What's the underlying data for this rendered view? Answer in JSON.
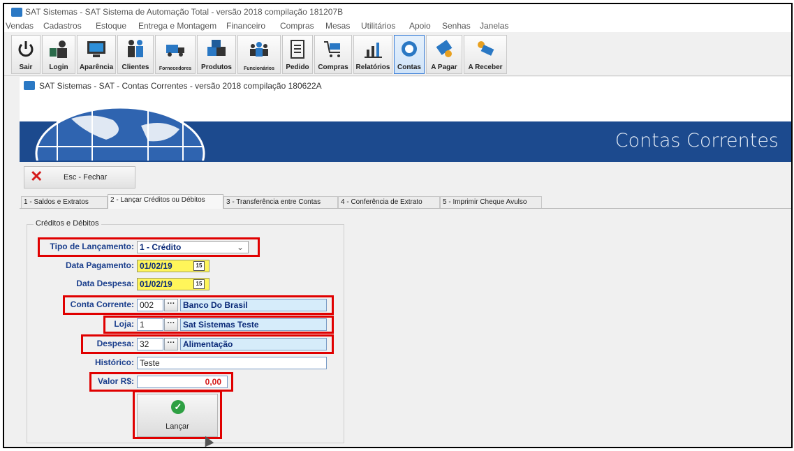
{
  "app": {
    "title": "SAT Sistemas - SAT Sistema de Automação Total - versão 2018 compilação 181207B"
  },
  "menu": [
    "Vendas",
    "Cadastros",
    "Estoque",
    "Entrega e Montagem",
    "Financeiro",
    "Compras",
    "Mesas",
    "Utilitários",
    "Apoio",
    "Senhas",
    "Janelas"
  ],
  "toolbar": [
    {
      "label": "Sair",
      "icon": "power-icon"
    },
    {
      "label": "Login",
      "icon": "login-icon"
    },
    {
      "label": "Aparência",
      "icon": "monitor-icon"
    },
    {
      "label": "Clientes",
      "icon": "clients-icon"
    },
    {
      "label": "Fornecedores",
      "icon": "truck-icon"
    },
    {
      "label": "Produtos",
      "icon": "boxes-icon"
    },
    {
      "label": "Funcionários",
      "icon": "team-icon"
    },
    {
      "label": "Pedido",
      "icon": "clipboard-icon"
    },
    {
      "label": "Compras",
      "icon": "cart-icon"
    },
    {
      "label": "Relatórios",
      "icon": "bar-chart-icon"
    },
    {
      "label": "Contas",
      "icon": "coins-icon"
    },
    {
      "label": "A Pagar",
      "icon": "pay-icon"
    },
    {
      "label": "A Receber",
      "icon": "receive-icon"
    }
  ],
  "child_window": {
    "title": "SAT Sistemas - SAT - Contas Correntes - versão 2018 compilação 180622A",
    "banner_title": "Contas Correntes",
    "close_label": "Esc - Fechar"
  },
  "tabs": [
    "1 - Saldos e Extratos",
    "2 - Lançar Créditos ou Débitos",
    "3 - Transferência entre Contas",
    "4 - Conferência de Extrato",
    "5 - Imprimir Cheque Avulso"
  ],
  "form": {
    "group_title": "Créditos e Débitos",
    "tipo_label": "Tipo de Lançamento:",
    "tipo_value": "1 - Crédito",
    "data_pagamento_label": "Data Pagamento:",
    "data_pagamento_value": "01/02/19",
    "data_despesa_label": "Data Despesa:",
    "data_despesa_value": "01/02/19",
    "conta_label": "Conta Corrente:",
    "conta_code": "002",
    "conta_name": "Banco Do Brasil",
    "loja_label": "Loja:",
    "loja_code": "1",
    "loja_name": "Sat Sistemas Teste",
    "despesa_label": "Despesa:",
    "despesa_code": "32",
    "despesa_name": "Alimentação",
    "historico_label": "Histórico:",
    "historico_value": "Teste",
    "valor_label": "Valor R$:",
    "valor_value": "0,00",
    "lancar_label": "Lançar",
    "dots": "···",
    "cal_glyph": "15"
  },
  "colors": {
    "highlight": "#e00000",
    "banner": "#1c4a8e",
    "yellow_field": "#fff55a",
    "blue_field": "#d6ecfa"
  }
}
